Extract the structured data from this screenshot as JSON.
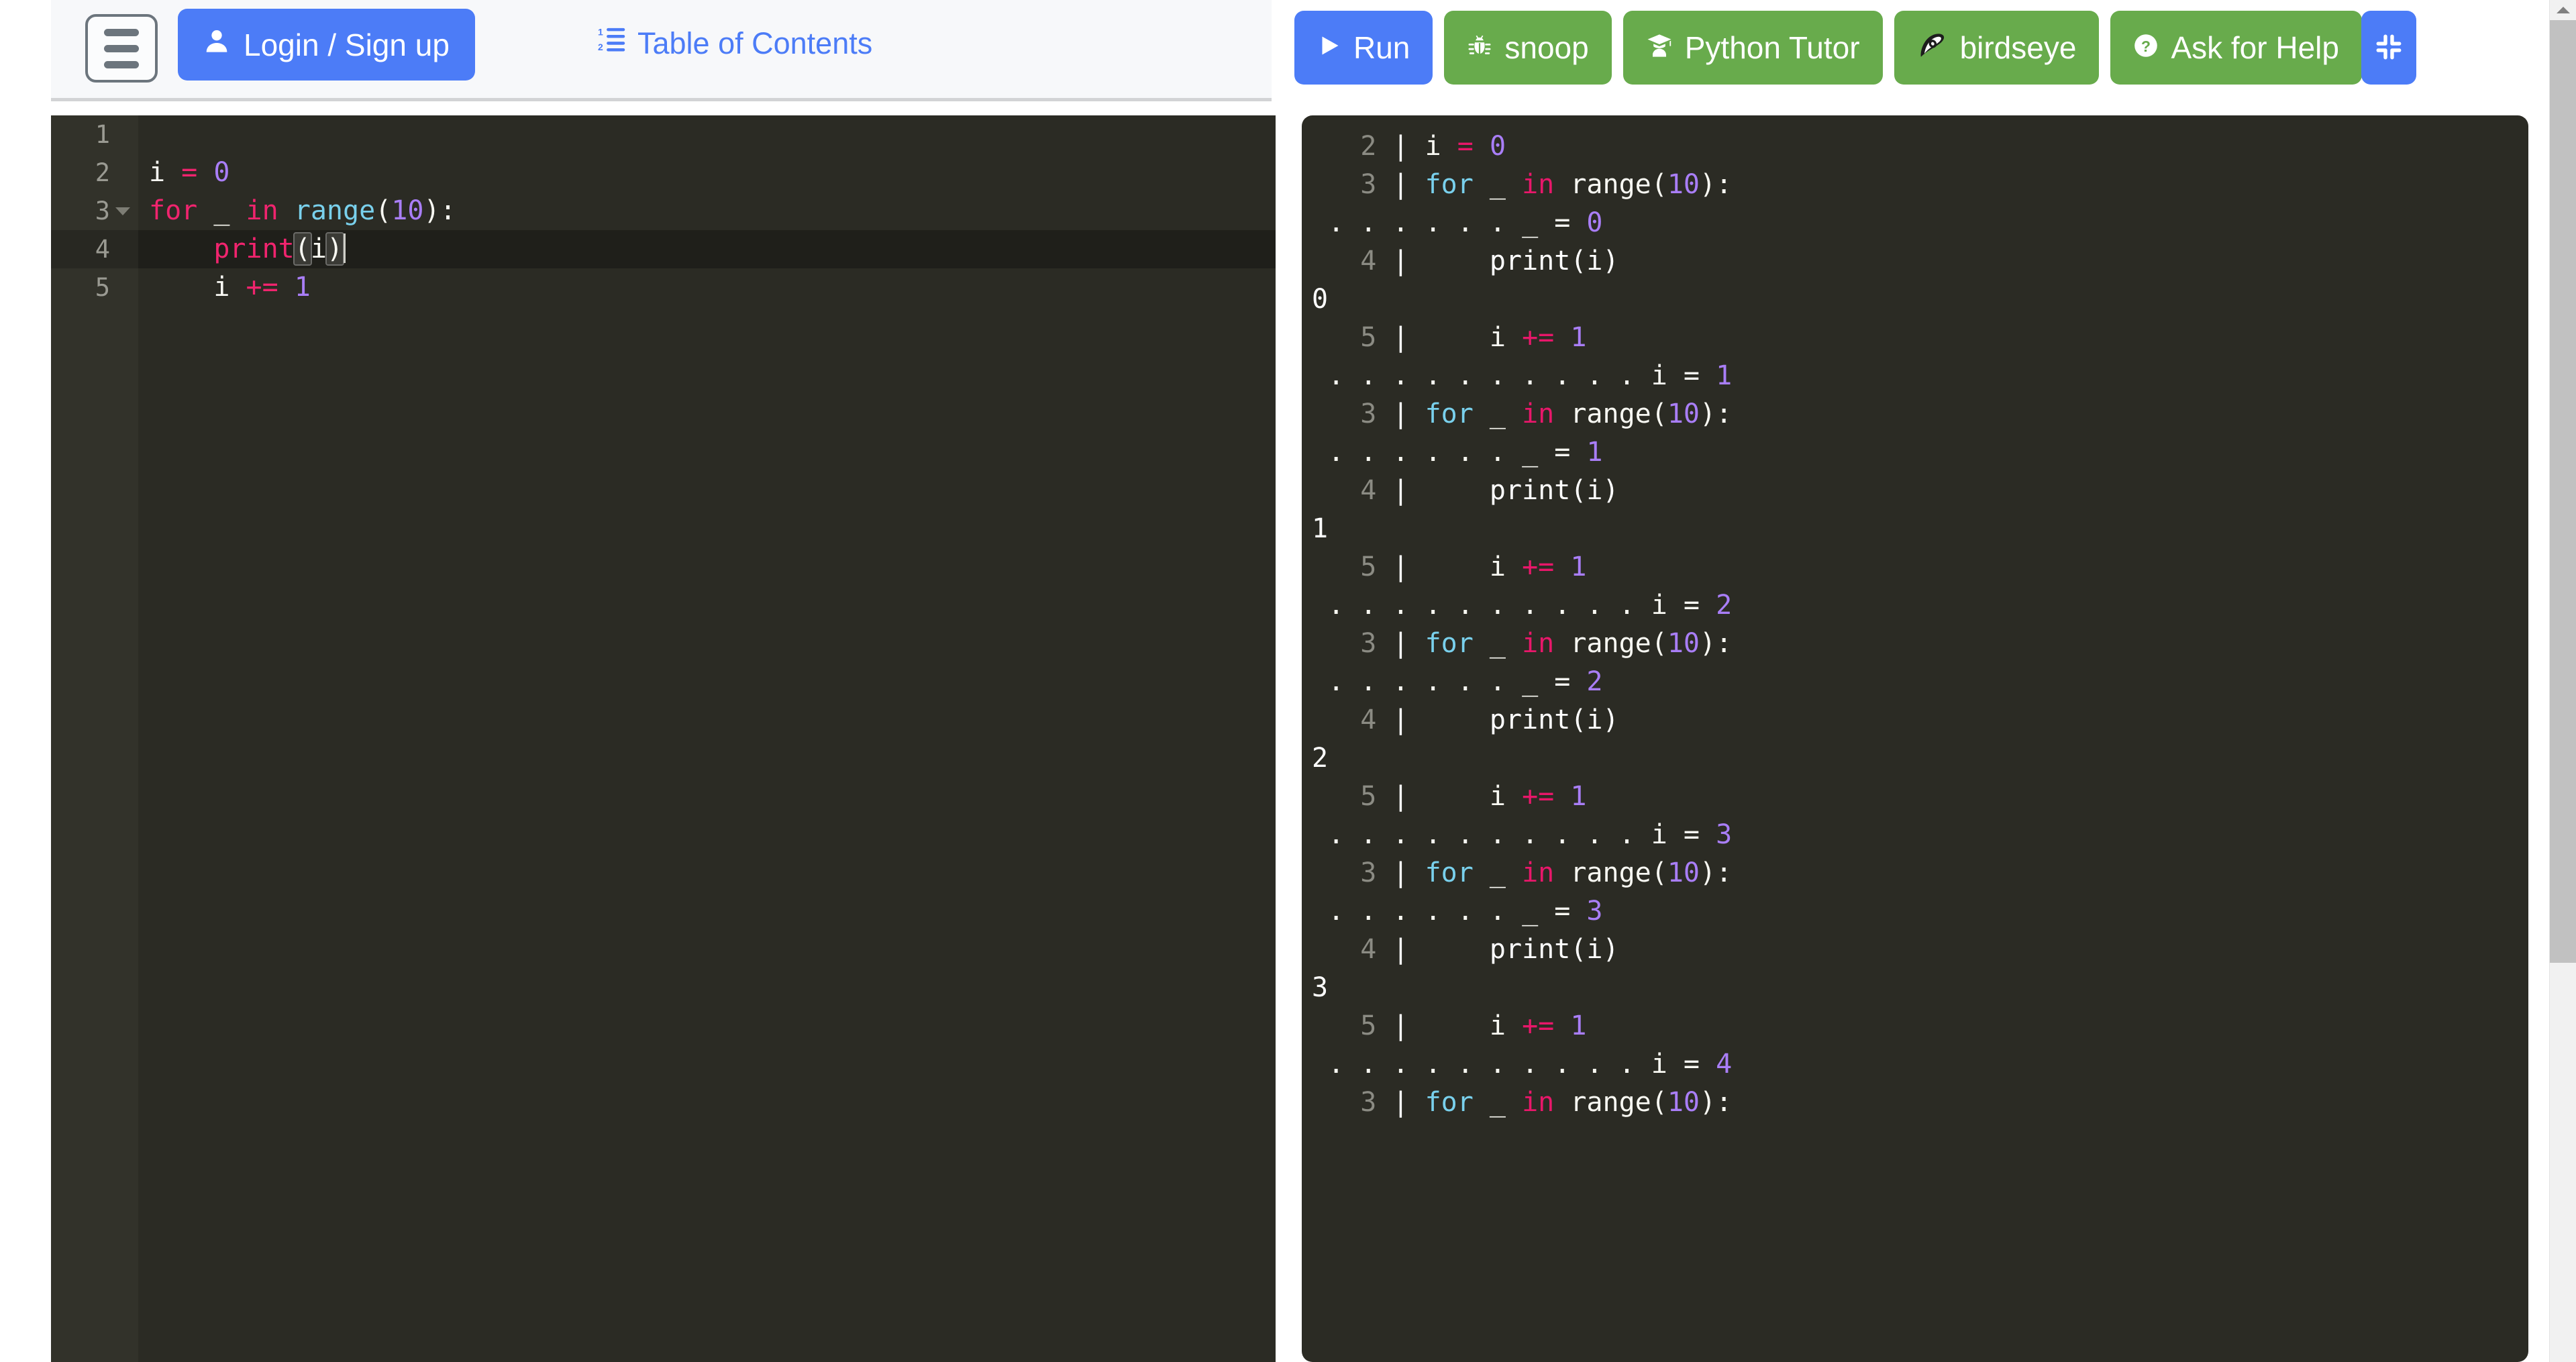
{
  "header": {
    "menu_icon": "hamburger-icon",
    "login_label": "Login / Sign up",
    "login_icon": "user-icon",
    "login_color": "#4c7cf7",
    "toc_label": "Table of Contents",
    "toc_icon": "ordered-list-icon",
    "toc_color": "#4c7cf7"
  },
  "toolbar": {
    "buttons": [
      {
        "label": "Run",
        "icon": "play-icon",
        "color": "#4c7cf7"
      },
      {
        "label": "snoop",
        "icon": "bug-icon",
        "color": "#68ab4c"
      },
      {
        "label": "Python Tutor",
        "icon": "graduate-icon",
        "color": "#68ab4c"
      },
      {
        "label": "birdseye",
        "icon": "eye-leaf-icon",
        "color": "#68ab4c"
      },
      {
        "label": "Ask for Help",
        "icon": "question-circle-icon",
        "color": "#68ab4c"
      }
    ],
    "fullscreen_icon": "compress-icon",
    "fullscreen_color": "#4c7cf7"
  },
  "editor": {
    "active_line": 4,
    "cursor_line": 4,
    "lines": [
      {
        "num": "1",
        "fold": false,
        "tokens": []
      },
      {
        "num": "2",
        "fold": false,
        "tokens": [
          {
            "t": "i ",
            "c": "c-txt"
          },
          {
            "t": "= ",
            "c": "c-op"
          },
          {
            "t": "0",
            "c": "c-num"
          }
        ]
      },
      {
        "num": "3",
        "fold": true,
        "tokens": [
          {
            "t": "for ",
            "c": "c-kw"
          },
          {
            "t": "_ ",
            "c": "c-txt"
          },
          {
            "t": "in ",
            "c": "c-kw"
          },
          {
            "t": "range",
            "c": "c-fn"
          },
          {
            "t": "(",
            "c": "c-txt"
          },
          {
            "t": "10",
            "c": "c-num"
          },
          {
            "t": "):",
            "c": "c-txt"
          }
        ]
      },
      {
        "num": "4",
        "fold": false,
        "tokens": [
          {
            "t": "    ",
            "c": "c-txt"
          },
          {
            "t": "print",
            "c": "c-kw"
          },
          {
            "t": "(",
            "c": "c-brk"
          },
          {
            "t": "i",
            "c": "c-txt"
          },
          {
            "t": ")",
            "c": "c-brk"
          }
        ]
      },
      {
        "num": "5",
        "fold": false,
        "tokens": [
          {
            "t": "    ",
            "c": "c-txt"
          },
          {
            "t": "i ",
            "c": "c-txt"
          },
          {
            "t": "+= ",
            "c": "c-op"
          },
          {
            "t": "1",
            "c": "c-num"
          }
        ]
      }
    ]
  },
  "output": {
    "rows": [
      {
        "tokens": [
          {
            "t": "   2 ",
            "c": "out-lineno"
          },
          {
            "t": "| ",
            "c": "out-bar"
          },
          {
            "t": "i ",
            "c": "o-txt"
          },
          {
            "t": "= ",
            "c": "o-op"
          },
          {
            "t": "0",
            "c": "o-num"
          }
        ]
      },
      {
        "tokens": [
          {
            "t": "   3 ",
            "c": "out-lineno"
          },
          {
            "t": "| ",
            "c": "out-bar"
          },
          {
            "t": "for ",
            "c": "o-for"
          },
          {
            "t": "_ ",
            "c": "o-txt"
          },
          {
            "t": "in ",
            "c": "o-in"
          },
          {
            "t": "range(",
            "c": "o-txt"
          },
          {
            "t": "10",
            "c": "o-num"
          },
          {
            "t": "):",
            "c": "o-txt"
          }
        ]
      },
      {
        "tokens": [
          {
            "t": " . . . . . . ",
            "c": "out-dots"
          },
          {
            "t": "_ = ",
            "c": "o-txt"
          },
          {
            "t": "0",
            "c": "o-num"
          }
        ]
      },
      {
        "tokens": [
          {
            "t": "   4 ",
            "c": "out-lineno"
          },
          {
            "t": "| ",
            "c": "out-bar"
          },
          {
            "t": "    print(i)",
            "c": "o-white"
          }
        ]
      },
      {
        "tokens": [
          {
            "t": "0",
            "c": "o-white"
          }
        ]
      },
      {
        "tokens": [
          {
            "t": "   5 ",
            "c": "out-lineno"
          },
          {
            "t": "| ",
            "c": "out-bar"
          },
          {
            "t": "    i ",
            "c": "o-txt"
          },
          {
            "t": "+= ",
            "c": "o-op"
          },
          {
            "t": "1",
            "c": "o-num"
          }
        ]
      },
      {
        "tokens": [
          {
            "t": " . . . . . . . . . . ",
            "c": "out-dots"
          },
          {
            "t": "i = ",
            "c": "o-txt"
          },
          {
            "t": "1",
            "c": "o-num"
          }
        ]
      },
      {
        "tokens": [
          {
            "t": "   3 ",
            "c": "out-lineno"
          },
          {
            "t": "| ",
            "c": "out-bar"
          },
          {
            "t": "for ",
            "c": "o-for"
          },
          {
            "t": "_ ",
            "c": "o-txt"
          },
          {
            "t": "in ",
            "c": "o-in"
          },
          {
            "t": "range(",
            "c": "o-txt"
          },
          {
            "t": "10",
            "c": "o-num"
          },
          {
            "t": "):",
            "c": "o-txt"
          }
        ]
      },
      {
        "tokens": [
          {
            "t": " . . . . . . ",
            "c": "out-dots"
          },
          {
            "t": "_ = ",
            "c": "o-txt"
          },
          {
            "t": "1",
            "c": "o-num"
          }
        ]
      },
      {
        "tokens": [
          {
            "t": "   4 ",
            "c": "out-lineno"
          },
          {
            "t": "| ",
            "c": "out-bar"
          },
          {
            "t": "    print(i)",
            "c": "o-white"
          }
        ]
      },
      {
        "tokens": [
          {
            "t": "1",
            "c": "o-white"
          }
        ]
      },
      {
        "tokens": [
          {
            "t": "   5 ",
            "c": "out-lineno"
          },
          {
            "t": "| ",
            "c": "out-bar"
          },
          {
            "t": "    i ",
            "c": "o-txt"
          },
          {
            "t": "+= ",
            "c": "o-op"
          },
          {
            "t": "1",
            "c": "o-num"
          }
        ]
      },
      {
        "tokens": [
          {
            "t": " . . . . . . . . . . ",
            "c": "out-dots"
          },
          {
            "t": "i = ",
            "c": "o-txt"
          },
          {
            "t": "2",
            "c": "o-num"
          }
        ]
      },
      {
        "tokens": [
          {
            "t": "   3 ",
            "c": "out-lineno"
          },
          {
            "t": "| ",
            "c": "out-bar"
          },
          {
            "t": "for ",
            "c": "o-for"
          },
          {
            "t": "_ ",
            "c": "o-txt"
          },
          {
            "t": "in ",
            "c": "o-in"
          },
          {
            "t": "range(",
            "c": "o-txt"
          },
          {
            "t": "10",
            "c": "o-num"
          },
          {
            "t": "):",
            "c": "o-txt"
          }
        ]
      },
      {
        "tokens": [
          {
            "t": " . . . . . . ",
            "c": "out-dots"
          },
          {
            "t": "_ = ",
            "c": "o-txt"
          },
          {
            "t": "2",
            "c": "o-num"
          }
        ]
      },
      {
        "tokens": [
          {
            "t": "   4 ",
            "c": "out-lineno"
          },
          {
            "t": "| ",
            "c": "out-bar"
          },
          {
            "t": "    print(i)",
            "c": "o-white"
          }
        ]
      },
      {
        "tokens": [
          {
            "t": "2",
            "c": "o-white"
          }
        ]
      },
      {
        "tokens": [
          {
            "t": "   5 ",
            "c": "out-lineno"
          },
          {
            "t": "| ",
            "c": "out-bar"
          },
          {
            "t": "    i ",
            "c": "o-txt"
          },
          {
            "t": "+= ",
            "c": "o-op"
          },
          {
            "t": "1",
            "c": "o-num"
          }
        ]
      },
      {
        "tokens": [
          {
            "t": " . . . . . . . . . . ",
            "c": "out-dots"
          },
          {
            "t": "i = ",
            "c": "o-txt"
          },
          {
            "t": "3",
            "c": "o-num"
          }
        ]
      },
      {
        "tokens": [
          {
            "t": "   3 ",
            "c": "out-lineno"
          },
          {
            "t": "| ",
            "c": "out-bar"
          },
          {
            "t": "for ",
            "c": "o-for"
          },
          {
            "t": "_ ",
            "c": "o-txt"
          },
          {
            "t": "in ",
            "c": "o-in"
          },
          {
            "t": "range(",
            "c": "o-txt"
          },
          {
            "t": "10",
            "c": "o-num"
          },
          {
            "t": "):",
            "c": "o-txt"
          }
        ]
      },
      {
        "tokens": [
          {
            "t": " . . . . . . ",
            "c": "out-dots"
          },
          {
            "t": "_ = ",
            "c": "o-txt"
          },
          {
            "t": "3",
            "c": "o-num"
          }
        ]
      },
      {
        "tokens": [
          {
            "t": "   4 ",
            "c": "out-lineno"
          },
          {
            "t": "| ",
            "c": "out-bar"
          },
          {
            "t": "    print(i)",
            "c": "o-white"
          }
        ]
      },
      {
        "tokens": [
          {
            "t": "3",
            "c": "o-white"
          }
        ]
      },
      {
        "tokens": [
          {
            "t": "   5 ",
            "c": "out-lineno"
          },
          {
            "t": "| ",
            "c": "out-bar"
          },
          {
            "t": "    i ",
            "c": "o-txt"
          },
          {
            "t": "+= ",
            "c": "o-op"
          },
          {
            "t": "1",
            "c": "o-num"
          }
        ]
      },
      {
        "tokens": [
          {
            "t": " . . . . . . . . . . ",
            "c": "out-dots"
          },
          {
            "t": "i = ",
            "c": "o-txt"
          },
          {
            "t": "4",
            "c": "o-num"
          }
        ]
      },
      {
        "tokens": [
          {
            "t": "   3 ",
            "c": "out-lineno"
          },
          {
            "t": "| ",
            "c": "out-bar"
          },
          {
            "t": "for ",
            "c": "o-for"
          },
          {
            "t": "_ ",
            "c": "o-txt"
          },
          {
            "t": "in ",
            "c": "o-in"
          },
          {
            "t": "range(",
            "c": "o-txt"
          },
          {
            "t": "10",
            "c": "o-num"
          },
          {
            "t": "):",
            "c": "o-txt"
          }
        ]
      }
    ]
  },
  "scrollbar": {
    "up_arrow_icon": "chevron-up-icon"
  }
}
